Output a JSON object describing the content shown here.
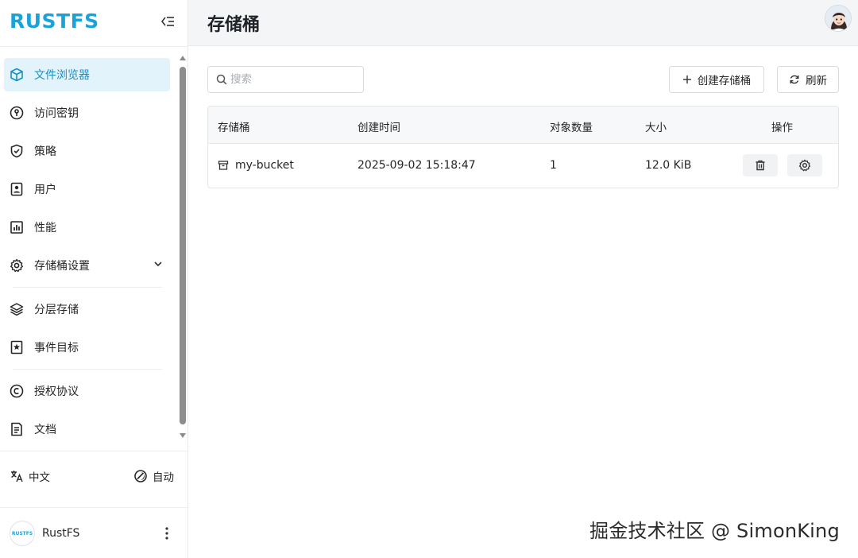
{
  "brand": {
    "name": "RUSTFS",
    "color": "#1aa3d9"
  },
  "sidebar": {
    "items": [
      {
        "label": "文件浏览器",
        "icon": "cube-icon",
        "active": true
      },
      {
        "label": "访问密钥",
        "icon": "key-circle-icon"
      },
      {
        "label": "策略",
        "icon": "shield-check-icon"
      },
      {
        "label": "用户",
        "icon": "user-card-icon"
      },
      {
        "label": "性能",
        "icon": "bar-chart-icon"
      },
      {
        "label": "存储桶设置",
        "icon": "gear-icon",
        "expandable": true
      },
      {
        "label": "分层存储",
        "icon": "layers-icon"
      },
      {
        "label": "事件目标",
        "icon": "star-bookmark-icon"
      },
      {
        "label": "授权协议",
        "icon": "copyright-icon"
      },
      {
        "label": "文档",
        "icon": "document-icon"
      }
    ],
    "language": "中文",
    "theme": "自动",
    "user": {
      "name": "RustFS",
      "avatar_text": "RUSTFS"
    }
  },
  "header": {
    "title": "存储桶"
  },
  "toolbar": {
    "search_placeholder": "搜索",
    "create_label": "创建存储桶",
    "refresh_label": "刷新"
  },
  "table": {
    "columns": [
      "存储桶",
      "创建时间",
      "对象数量",
      "大小",
      "操作"
    ],
    "rows": [
      {
        "name": "my-bucket",
        "created": "2025-09-02 15:18:47",
        "objects": "1",
        "size": "12.0 KiB"
      }
    ]
  },
  "watermark": "掘金技术社区 @ SimonKing",
  "colors": {
    "accent": "#1a8fc4",
    "active_bg": "#e2f3fb"
  }
}
